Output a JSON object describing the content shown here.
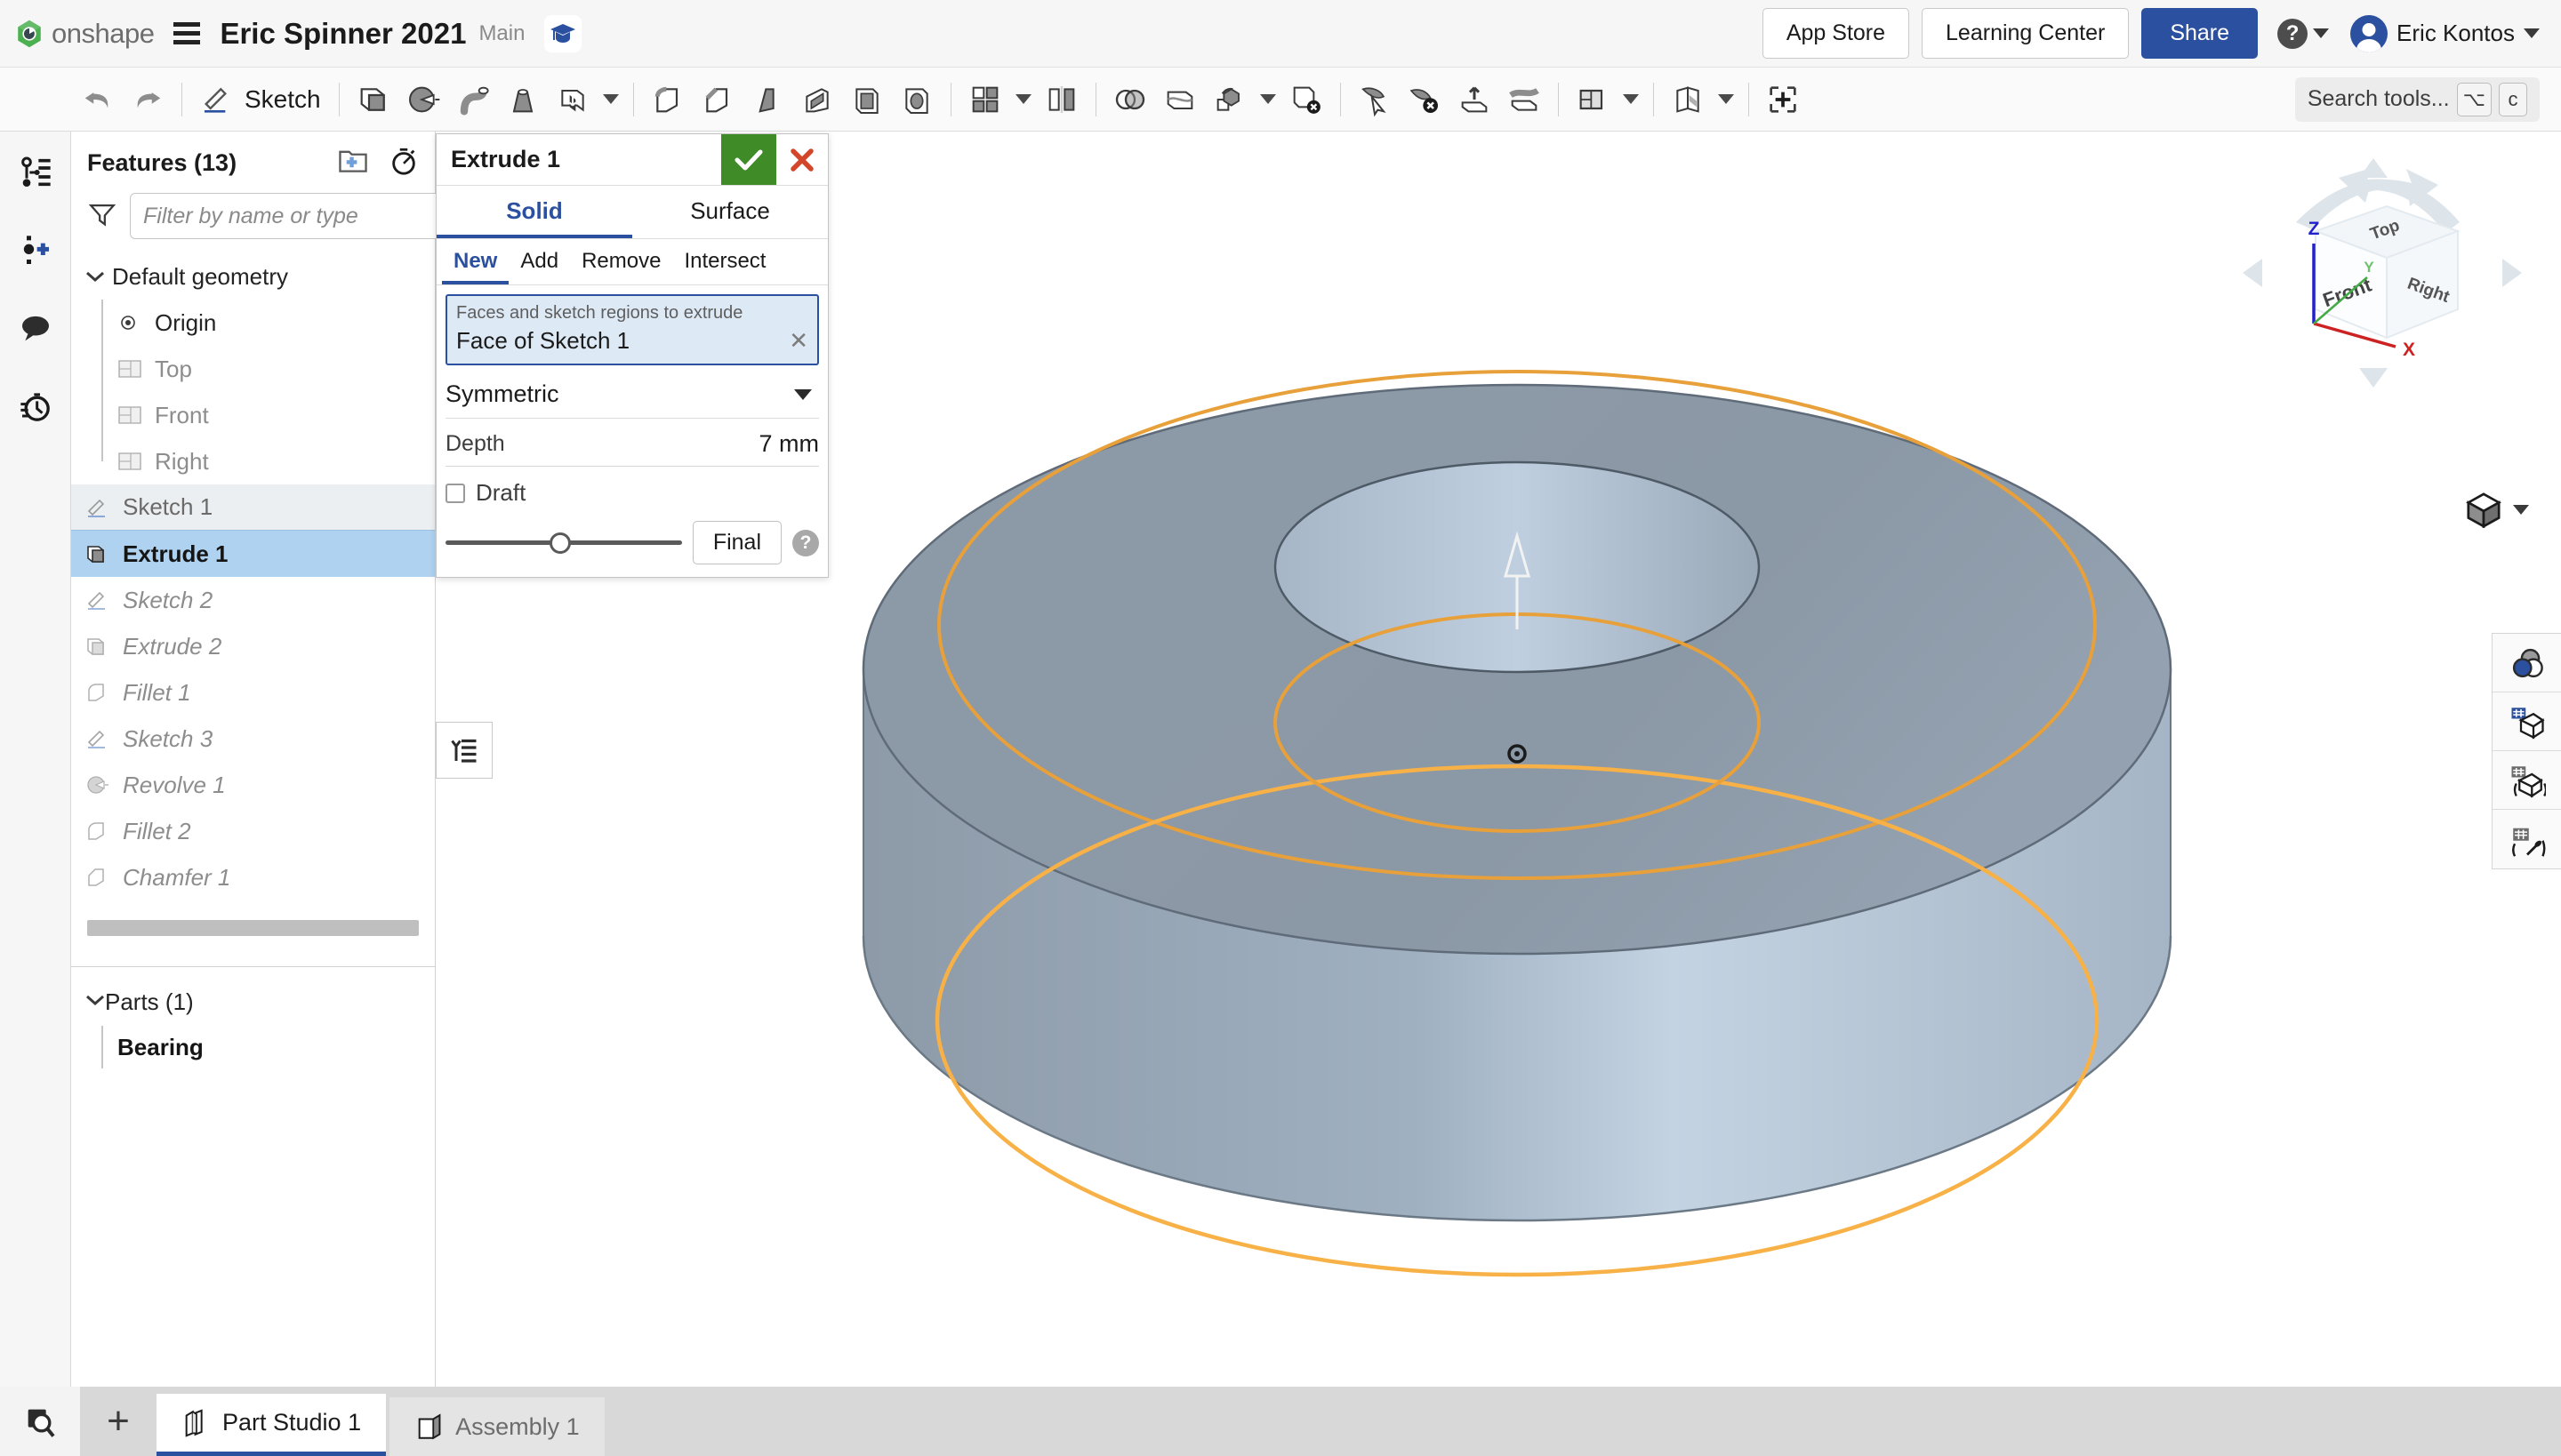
{
  "header": {
    "logo_text": "onshape",
    "menu_icon": "hamburger-icon",
    "doc_title": "Eric Spinner 2021",
    "branch": "Main",
    "grad_icon": "graduation-cap-icon",
    "app_store": "App Store",
    "learning_center": "Learning Center",
    "share": "Share",
    "help_glyph": "?",
    "user_name": "Eric Kontos",
    "accent_blue": "#2c50a0"
  },
  "toolbar": {
    "undo_icon": "undo-arrow-icon",
    "redo_icon": "redo-arrow-icon",
    "sketch_label": "Sketch",
    "sketch_icon": "pencil-icon",
    "tools": [
      {
        "name": "extrude-tool",
        "icon": "extrude-icon"
      },
      {
        "name": "revolve-tool",
        "icon": "revolve-icon"
      },
      {
        "name": "sweep-tool",
        "icon": "sweep-icon"
      },
      {
        "name": "loft-tool",
        "icon": "loft-icon"
      },
      {
        "name": "thicken-tool",
        "icon": "thicken-icon"
      },
      {
        "name": "fillet-tool",
        "icon": "fillet-icon"
      },
      {
        "name": "chamfer-tool",
        "icon": "chamfer-icon"
      },
      {
        "name": "draft-tool",
        "icon": "draft-icon"
      },
      {
        "name": "rib-tool",
        "icon": "rib-icon"
      },
      {
        "name": "shell-tool",
        "icon": "shell-icon"
      },
      {
        "name": "hole-tool",
        "icon": "hole-icon"
      },
      {
        "name": "pattern-tool",
        "icon": "pattern-icon"
      },
      {
        "name": "mirror-tool",
        "icon": "mirror-icon"
      },
      {
        "name": "boolean-tool",
        "icon": "boolean-icon"
      },
      {
        "name": "split-tool",
        "icon": "split-icon"
      },
      {
        "name": "transform-tool",
        "icon": "transform-icon"
      },
      {
        "name": "delete-part-tool",
        "icon": "delete-part-icon"
      },
      {
        "name": "move-face-tool",
        "icon": "move-face-icon"
      },
      {
        "name": "delete-face-tool",
        "icon": "delete-face-icon"
      },
      {
        "name": "extend-surface-tool",
        "icon": "extend-surface-icon"
      },
      {
        "name": "enclose-tool",
        "icon": "enclose-icon"
      },
      {
        "name": "plane-tool",
        "icon": "plane-icon"
      },
      {
        "name": "sketch-plane-tool",
        "icon": "sketch-plane-icon"
      },
      {
        "name": "insert-feature-tool",
        "icon": "insert-plus-icon"
      }
    ],
    "search_placeholder": "Search tools...",
    "kbd_1": "⌥",
    "kbd_2": "c"
  },
  "left_rail": {
    "items": [
      {
        "name": "feature-list-icon"
      },
      {
        "name": "add-version-icon"
      },
      {
        "name": "comments-icon"
      },
      {
        "name": "history-icon"
      }
    ]
  },
  "features_panel": {
    "title": "Features (13)",
    "new-folder-icon": "new-folder-icon",
    "rollback-icon": "stopwatch-icon",
    "filter_placeholder": "Filter by name or type",
    "filter_value": "",
    "filter_icon": "funnel-icon",
    "group_label": "Default geometry",
    "default_geometry": [
      {
        "label": "Origin",
        "icon": "origin-icon",
        "state": "normal"
      },
      {
        "label": "Top",
        "icon": "plane-icon",
        "state": "muted"
      },
      {
        "label": "Front",
        "icon": "plane-icon",
        "state": "muted"
      },
      {
        "label": "Right",
        "icon": "plane-icon",
        "state": "muted"
      }
    ],
    "features": [
      {
        "label": "Sketch 1",
        "icon": "sketch-icon",
        "state": "sel-light"
      },
      {
        "label": "Extrude 1",
        "icon": "extrude-icon",
        "state": "sel-strong"
      },
      {
        "label": "Sketch 2",
        "icon": "sketch-icon",
        "state": "italic"
      },
      {
        "label": "Extrude 2",
        "icon": "extrude-icon",
        "state": "italic"
      },
      {
        "label": "Fillet 1",
        "icon": "fillet-icon",
        "state": "italic"
      },
      {
        "label": "Sketch 3",
        "icon": "sketch-icon",
        "state": "italic"
      },
      {
        "label": "Revolve 1",
        "icon": "revolve-icon",
        "state": "italic"
      },
      {
        "label": "Fillet 2",
        "icon": "fillet-icon",
        "state": "italic"
      },
      {
        "label": "Chamfer 1",
        "icon": "chamfer-icon",
        "state": "italic"
      }
    ],
    "parts_title": "Parts (1)",
    "parts": [
      {
        "label": "Bearing"
      }
    ]
  },
  "extrude_dialog": {
    "title": "Extrude 1",
    "accept_icon": "checkmark-icon",
    "cancel_icon": "close-x-icon",
    "tabs": [
      {
        "label": "Solid",
        "active": true
      },
      {
        "label": "Surface",
        "active": false
      }
    ],
    "operations": [
      {
        "label": "New",
        "active": true
      },
      {
        "label": "Add",
        "active": false
      },
      {
        "label": "Remove",
        "active": false
      },
      {
        "label": "Intersect",
        "active": false
      }
    ],
    "selection_hint": "Faces and sketch regions to extrude",
    "selection_value": "Face of Sketch 1",
    "selection_clear_icon": "clear-x-icon",
    "end_type": "Symmetric",
    "depth_label": "Depth",
    "depth_value": "7 mm",
    "draft_label": "Draft",
    "draft_checked": false,
    "final_label": "Final",
    "help_glyph": "?",
    "accent_blue": "#2c50a0",
    "ok_green": "#3e8b28",
    "cancel_red": "#d2472a"
  },
  "list_button": {
    "icon": "feature-list-toggle-icon"
  },
  "viewport": {
    "view_cube": {
      "top_label": "Top",
      "front_label": "Front",
      "right_label": "Right",
      "axis_x": "X",
      "axis_y": "Y",
      "axis_z": "Z",
      "x_color": "#cc2222",
      "y_color": "#44aa44",
      "z_color": "#2222cc"
    },
    "view_mode_icon": "shaded-cube-icon",
    "model": {
      "name": "Bearing",
      "body_color": "#8d9aa8",
      "body_light": "#b7c6d6",
      "sketch_color": "#f0a030",
      "edge_color": "#4a5560",
      "direction_arrow_icon": "extrude-direction-arrow-icon",
      "origin_point_icon": "origin-point-icon"
    }
  },
  "right_rail": {
    "items": [
      {
        "name": "appearance-icon"
      },
      {
        "name": "display-state-icon"
      },
      {
        "name": "section-view-icon"
      },
      {
        "name": "measure-icon"
      }
    ]
  },
  "bottom": {
    "search_icon": "search-element-icon",
    "plus_icon": "add-tab-icon",
    "tabs": [
      {
        "label": "Part Studio 1",
        "icon": "part-studio-icon",
        "active": true
      },
      {
        "label": "Assembly 1",
        "icon": "assembly-icon",
        "active": false
      }
    ]
  }
}
